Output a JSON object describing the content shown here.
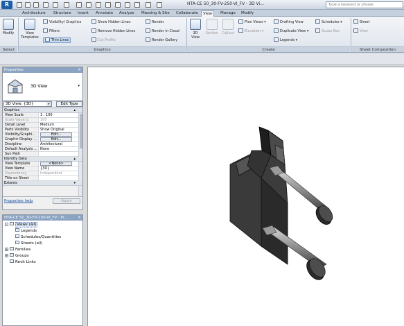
{
  "title_bar": {
    "app_button": "R",
    "document_title": "HTA-CE 50_30-FV-250-VI_FV - 3D Vi...",
    "search_placeholder": "Type a keyword or phrase"
  },
  "tabs": [
    "Architecture",
    "Structure",
    "Insert",
    "Annotate",
    "Analyze",
    "Massing & Site",
    "Collaborate",
    "View",
    "Manage",
    "Modify"
  ],
  "active_tab": "View",
  "ribbon": {
    "select": {
      "modify": "Modify",
      "panel": "Select"
    },
    "graphics": {
      "view_templates": "View Templates",
      "visibility_graphics": "Visibility/ Graphics",
      "filters": "Filters",
      "thin_lines": "Thin Lines",
      "show_hidden_lines": "Show Hidden Lines",
      "remove_hidden_lines": "Remove Hidden Lines",
      "cut_profile": "Cut Profile",
      "render": "Render",
      "render_in_cloud": "Render in Cloud",
      "render_gallery": "Render Gallery",
      "panel": "Graphics"
    },
    "create": {
      "view_3d": "3D View",
      "section": "Section",
      "callout": "Callout",
      "plan_views": "Plan Views",
      "elevation": "Elevation",
      "drafting_view": "Drafting View",
      "duplicate_view": "Duplicate View",
      "legends": "Legends",
      "schedules": "Schedules",
      "scope_box": "Scope Box",
      "panel": "Create"
    },
    "sheet_composition": {
      "sheet": "Sheet",
      "view": "View",
      "panel": "Sheet Composition"
    }
  },
  "properties": {
    "title": "Properties",
    "type_name": "3D View",
    "instance_selector": "3D View: {3D}",
    "edit_type": "Edit Type",
    "groups": [
      {
        "name": "Graphics",
        "rows": [
          {
            "k": "View Scale",
            "v": "1 : 100",
            "dis": false
          },
          {
            "k": "Scale Value 1:",
            "v": "100",
            "dis": true
          },
          {
            "k": "Detail Level",
            "v": "Medium",
            "dis": false
          },
          {
            "k": "Parts Visibility",
            "v": "Show Original",
            "dis": false
          },
          {
            "k": "Visibility/Graphi...",
            "v": "Edit...",
            "dis": false,
            "btn": true
          },
          {
            "k": "Graphic Display ...",
            "v": "Edit...",
            "dis": false,
            "btn": true
          },
          {
            "k": "Discipline",
            "v": "Architectural",
            "dis": false
          },
          {
            "k": "Default Analysis ...",
            "v": "None",
            "dis": false
          },
          {
            "k": "Sun Path",
            "v": "",
            "dis": false
          }
        ]
      },
      {
        "name": "Identity Data",
        "rows": [
          {
            "k": "View Template",
            "v": "<None>",
            "dis": false,
            "btn": true
          },
          {
            "k": "View Name",
            "v": "{3D}",
            "dis": false
          },
          {
            "k": "Dependency",
            "v": "Independent",
            "dis": true
          },
          {
            "k": "Title on Sheet",
            "v": "",
            "dis": false
          }
        ]
      },
      {
        "name": "Extents",
        "rows": []
      }
    ],
    "help_link": "Properties help",
    "apply": "Apply"
  },
  "project_browser": {
    "title": "HTA-CE 50_30-FV-250-VI_FV - Pr...",
    "nodes": [
      {
        "label": "Views (all)",
        "exp": "-",
        "indent": 0,
        "sel": true
      },
      {
        "label": "Legends",
        "exp": "",
        "indent": 1,
        "sel": false
      },
      {
        "label": "Schedules/Quantities",
        "exp": "",
        "indent": 1,
        "sel": false
      },
      {
        "label": "Sheets (all)",
        "exp": "",
        "indent": 1,
        "sel": false
      },
      {
        "label": "Families",
        "exp": "+",
        "indent": 0,
        "sel": false
      },
      {
        "label": "Groups",
        "exp": "+",
        "indent": 0,
        "sel": false
      },
      {
        "label": "Revit Links",
        "exp": "",
        "indent": 0,
        "sel": false
      }
    ]
  },
  "colors": {
    "ribbon_bg": "#eef2f7",
    "palette_title": "#8aa3c2",
    "model_dark": "#2b2b2b"
  }
}
